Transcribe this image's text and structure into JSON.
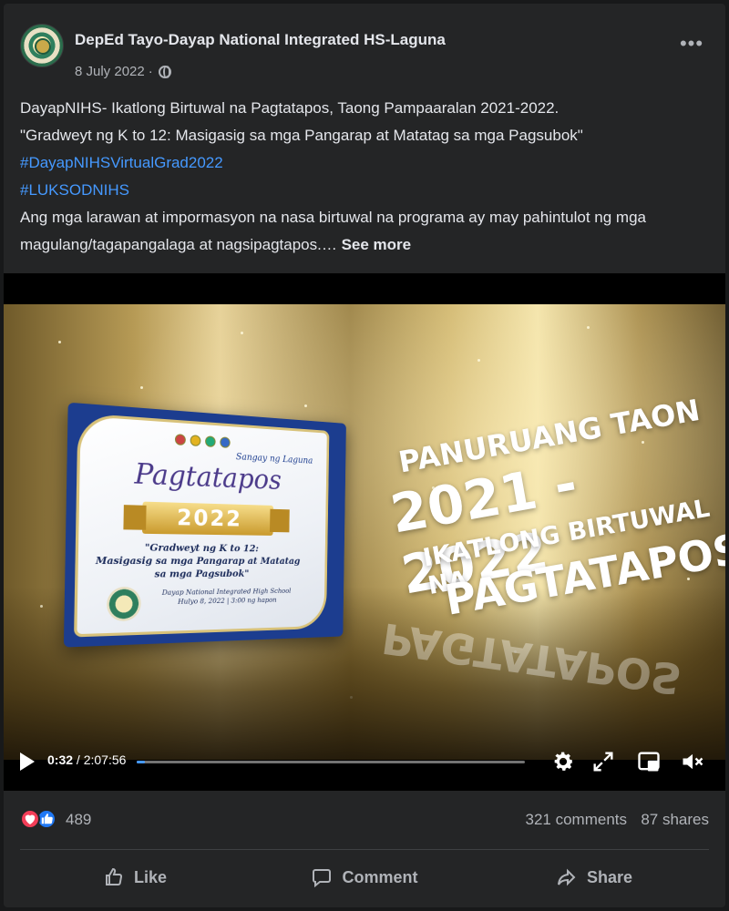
{
  "post": {
    "page_name": "DepEd Tayo-Dayap National Integrated HS-Laguna",
    "date": "8 July 2022",
    "dot": "·",
    "text_line1": "DayapNIHS- Ikatlong Birtuwal na Pagtatapos, Taong Pampaaralan 2021-2022.",
    "text_line2": "\"Gradweyt ng K to 12: Masigasig sa mga Pangarap at Matatag sa mga Pagsubok\"",
    "hashtag1": "#DayapNIHSVirtualGrad2022",
    "hashtag2": "#LUKSODNIHS",
    "text_line3": "Ang mga larawan at impormasyon na nasa birtuwal na programa ay may pahintulot ng mga",
    "text_line4": "magulang/tagapangalaga at nagsipagtapos.…",
    "see_more": "See more"
  },
  "video": {
    "frame_title_line1": "PANURUANG TAON",
    "frame_title_line2": "2021 - 2022",
    "frame_title_line3": "IKATLONG BIRTUWAL NA",
    "frame_title_line4": "PAGTATAPOS",
    "reflection_text": "PAGTATAPOS",
    "certificate": {
      "division": "Sangay ng Laguna",
      "title": "Pagtatapos",
      "year": "2022",
      "theme_line1": "\"Gradweyt ng K to 12:",
      "theme_line2": "Masigasig sa mga Pangarap at Matatag sa mga Pagsubok\"",
      "school_line1": "Dayap National Integrated High School",
      "school_line2": "Hulyo 8, 2022 | 3:00 ng hapon"
    },
    "current_time": "0:32",
    "separator": "/",
    "duration": "2:07:56",
    "progress": 0.004
  },
  "stats": {
    "reactions_count": "489",
    "comments": "321 comments",
    "shares": "87 shares"
  },
  "actions": {
    "like": "Like",
    "comment": "Comment",
    "share": "Share"
  },
  "colors": {
    "background": "#242526",
    "text_primary": "#e4e6eb",
    "text_secondary": "#b0b3b8",
    "link": "#4599ff",
    "love": "#f33e58",
    "like": "#2078f4"
  }
}
